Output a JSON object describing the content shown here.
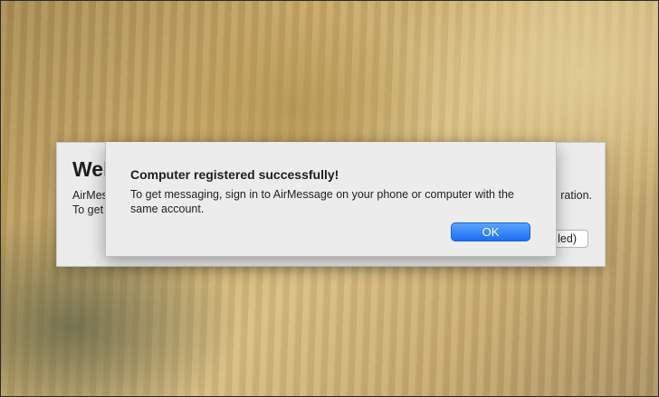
{
  "background_window": {
    "title": "Welc",
    "body_line1": "AirMes",
    "body_line2": "To get",
    "body_tail": "ration.",
    "button_label": "led)"
  },
  "alert": {
    "title": "Computer registered successfully!",
    "message": "To get messaging, sign in to AirMessage on your phone or computer with the same account.",
    "ok_label": "OK"
  },
  "colors": {
    "accent": "#1c6ff2",
    "dialog_bg": "#ececec"
  }
}
